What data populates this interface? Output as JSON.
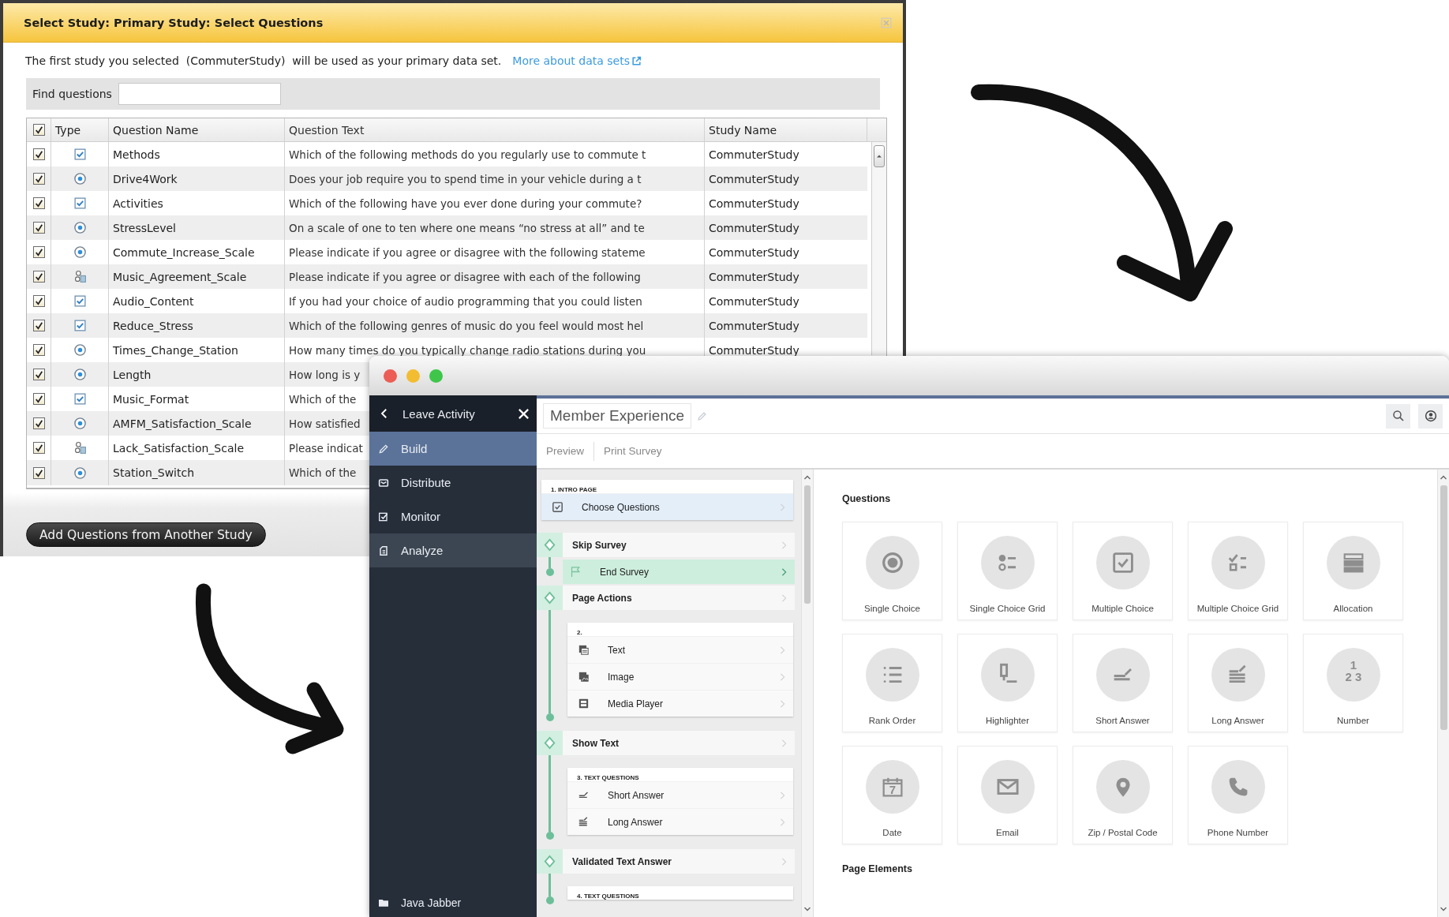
{
  "dialog": {
    "title": "Select Study: Primary Study: Select Questions",
    "intro": "The first study you selected  (CommuterStudy)  will be used as your primary data set.",
    "link": "More about data sets",
    "search": {
      "label": "Find questions"
    },
    "table": {
      "all_checked": true,
      "columns": [
        "Type",
        "Question Name",
        "Question Text",
        "Study Name"
      ],
      "rows": [
        {
          "checked": true,
          "kind": "multiple",
          "name": "Methods",
          "text": "Which of the following methods do you regularly use to commute t",
          "study": "CommuterStudy"
        },
        {
          "checked": true,
          "kind": "single",
          "name": "Drive4Work",
          "text": "Does your job require you to spend time in your vehicle during a t",
          "study": "CommuterStudy"
        },
        {
          "checked": true,
          "kind": "multiple",
          "name": "Activities",
          "text": "Which of the following have you ever done during your commute?",
          "study": "CommuterStudy"
        },
        {
          "checked": true,
          "kind": "single",
          "name": "StressLevel",
          "text": "On a scale of one to ten where one means “no stress at all” and te",
          "study": "CommuterStudy"
        },
        {
          "checked": true,
          "kind": "single",
          "name": "Commute_Increase_Scale",
          "text": "Please indicate if you agree or disagree with the following stateme",
          "study": "CommuterStudy"
        },
        {
          "checked": true,
          "kind": "grid",
          "name": "Music_Agreement_Scale",
          "text": "Please indicate if you agree or disagree with each of the following",
          "study": "CommuterStudy"
        },
        {
          "checked": true,
          "kind": "multiple",
          "name": "Audio_Content",
          "text": "If you had your choice of audio programming that you could listen",
          "study": "CommuterStudy"
        },
        {
          "checked": true,
          "kind": "multiple",
          "name": "Reduce_Stress",
          "text": "Which of the following genres of music do you feel would most hel",
          "study": "CommuterStudy"
        },
        {
          "checked": true,
          "kind": "single",
          "name": "Times_Change_Station",
          "text": "How many times do you typically change radio stations during you",
          "study": "CommuterStudy"
        },
        {
          "checked": true,
          "kind": "single",
          "name": "Length",
          "text": "How long is y"
        },
        {
          "checked": true,
          "kind": "multiple",
          "name": "Music_Format",
          "text": "Which of the"
        },
        {
          "checked": true,
          "kind": "single",
          "name": "AMFM_Satisfaction_Scale",
          "text": "How satisfied"
        },
        {
          "checked": true,
          "kind": "grid",
          "name": "Lack_Satisfaction_Scale",
          "text": "Please indicat"
        },
        {
          "checked": true,
          "kind": "single",
          "name": "Station_Switch",
          "text": "Which of the"
        }
      ]
    },
    "button": "Add Questions from Another Study"
  },
  "builder": {
    "sidebar": {
      "back": "Leave Activity",
      "items": [
        {
          "label": "Build",
          "kind": "pencil",
          "selected": true,
          "highlighted": false
        },
        {
          "label": "Distribute",
          "kind": "envelope-small",
          "selected": false,
          "highlighted": false
        },
        {
          "label": "Monitor",
          "kind": "monitor",
          "selected": false,
          "highlighted": false
        },
        {
          "label": "Analyze",
          "kind": "document",
          "selected": false,
          "highlighted": true
        }
      ],
      "footer": "Java Jabber"
    },
    "title": "Member Experience",
    "toolbar": [
      "Preview",
      "Print Survey"
    ],
    "outline": [
      {
        "kind": "page",
        "heading": "1. INTRO PAGE",
        "items": [
          {
            "label": "Choose Questions",
            "kind": "checkbox",
            "selected": true
          }
        ]
      },
      {
        "kind": "action",
        "title": "Skip Survey",
        "items": [
          {
            "label": "End Survey",
            "kind": "flag",
            "selected": true
          }
        ]
      },
      {
        "kind": "action",
        "title": "Page Actions",
        "page": {
          "heading": "2.",
          "items": [
            {
              "label": "Text",
              "kind": "text",
              "selected": false
            },
            {
              "label": "Image",
              "kind": "image",
              "selected": false
            },
            {
              "label": "Media Player",
              "kind": "media",
              "selected": false
            }
          ]
        }
      },
      {
        "kind": "action",
        "title": "Show Text",
        "page": {
          "heading": "3. TEXT QUESTIONS",
          "items": [
            {
              "label": "Short Answer",
              "kind": "short",
              "selected": false
            },
            {
              "label": "Long Answer",
              "kind": "long",
              "selected": false
            }
          ]
        }
      },
      {
        "kind": "action",
        "title": "Validated Text Answer",
        "page": {
          "heading": "4. TEXT QUESTIONS"
        }
      }
    ],
    "palette": [
      {
        "title": "Questions",
        "tiles": [
          {
            "label": "Single Choice",
            "kind": "radio"
          },
          {
            "label": "Single Choice Grid",
            "kind": "radio-list"
          },
          {
            "label": "Multiple Choice",
            "kind": "checkbox"
          },
          {
            "label": "Multiple Choice Grid",
            "kind": "check-list"
          },
          {
            "label": "Allocation",
            "kind": "bars"
          },
          {
            "label": "Rank Order",
            "kind": "numbered-list"
          },
          {
            "label": "Highlighter",
            "kind": "highlighter"
          },
          {
            "label": "Short Answer",
            "kind": "short"
          },
          {
            "label": "Long Answer",
            "kind": "long"
          },
          {
            "label": "Number",
            "kind": "number",
            "icon_text": [
              "1",
              "2 3"
            ]
          },
          {
            "label": "Date",
            "kind": "calendar",
            "icon_text": [
              "7"
            ]
          },
          {
            "label": "Email",
            "kind": "envelope"
          },
          {
            "label": "Zip / Postal Code",
            "kind": "pin"
          },
          {
            "label": "Phone Number",
            "kind": "phone"
          }
        ]
      },
      {
        "title": "Page Elements"
      }
    ]
  }
}
